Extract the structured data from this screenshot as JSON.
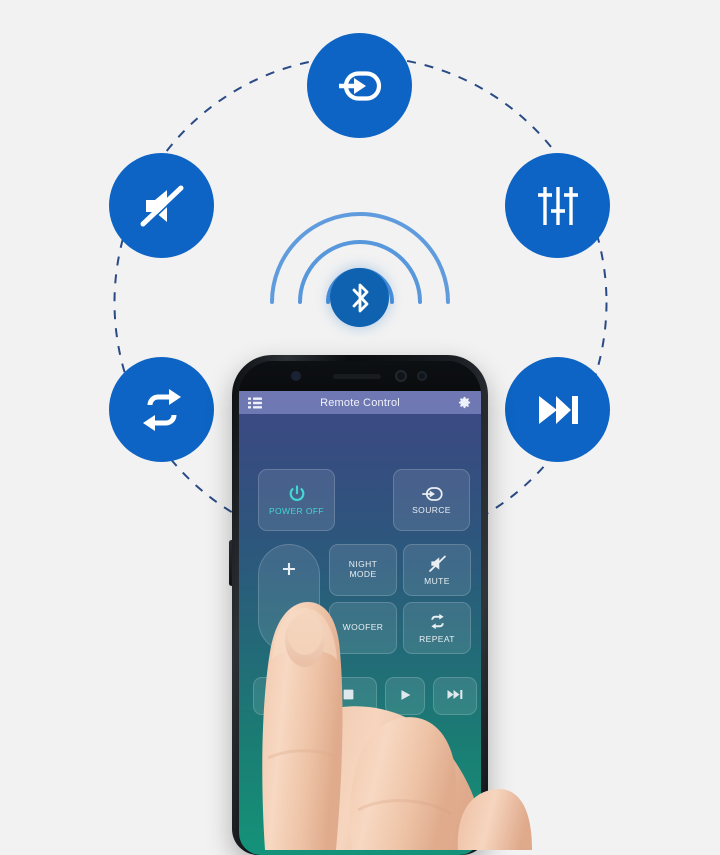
{
  "theme": {
    "background": "#f2f2f2",
    "brand_blue": "#0d64c4",
    "bluetooth_blue": "#0f62b0",
    "dash_stroke": "#2a4a86",
    "screen_top": "#3f4a86",
    "screen_bottom": "#14927a",
    "accent_cyan": "#44d6d0"
  },
  "feature_icons": [
    {
      "name": "source-icon",
      "label": "Source"
    },
    {
      "name": "mute-icon",
      "label": "Mute"
    },
    {
      "name": "equalizer-icon",
      "label": "Equalizer"
    },
    {
      "name": "repeat-icon",
      "label": "Repeat"
    },
    {
      "name": "next-track-icon",
      "label": "Next Track"
    }
  ],
  "bluetooth": {
    "icon": "bluetooth-icon",
    "waves": 3
  },
  "phone": {
    "app": {
      "titlebar": {
        "menu_icon": "list-menu-icon",
        "title": "Remote Control",
        "settings_icon": "gear-icon"
      },
      "buttons": {
        "power": {
          "label": "POWER OFF",
          "icon": "power-icon"
        },
        "source": {
          "label": "SOURCE",
          "icon": "source-icon"
        },
        "volume_up": {
          "label": "+",
          "icon": "plus-icon"
        },
        "night": {
          "label": "NIGHT\nMODE",
          "line1": "NIGHT",
          "line2": "MODE"
        },
        "mute": {
          "label": "MUTE",
          "icon": "mute-icon"
        },
        "woofer": {
          "label": "WOOFER"
        },
        "repeat": {
          "label": "REPEAT",
          "icon": "repeat-icon"
        }
      },
      "transport": [
        {
          "name": "prev-button",
          "icon": "prev-track-icon"
        },
        {
          "name": "stop-button",
          "icon": "stop-icon"
        },
        {
          "name": "play-button",
          "icon": "play-icon"
        },
        {
          "name": "next-button",
          "icon": "next-track-icon"
        }
      ]
    }
  }
}
